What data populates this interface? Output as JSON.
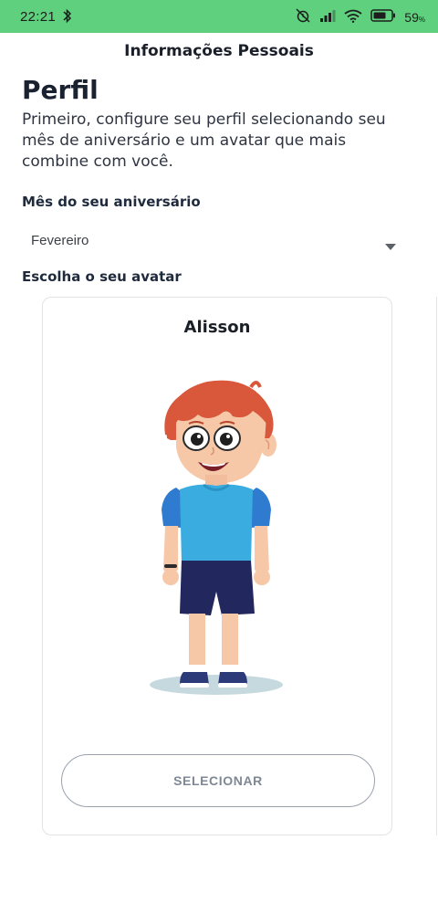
{
  "status_bar": {
    "time": "22:21",
    "battery_percent": "59",
    "battery_unit": "%",
    "color": "#5fd07e"
  },
  "header": {
    "title": "Informações Pessoais"
  },
  "profile": {
    "heading": "Perfil",
    "intro": "Primeiro, configure seu perfil selecionando seu mês de aniversário e um avatar que mais combine com você."
  },
  "birthday": {
    "label": "Mês do seu aniversário",
    "selected_month": "Fevereiro"
  },
  "avatar_picker": {
    "label": "Escolha o seu avatar",
    "current_avatar": {
      "name": "Alisson",
      "select_label": "SELECIONAR"
    }
  },
  "icons": {
    "status": [
      "bluetooth-icon",
      "mute-alarm-icon",
      "signal-icon",
      "wifi-icon",
      "battery-icon"
    ],
    "dropdown": "chevron-down-icon"
  }
}
